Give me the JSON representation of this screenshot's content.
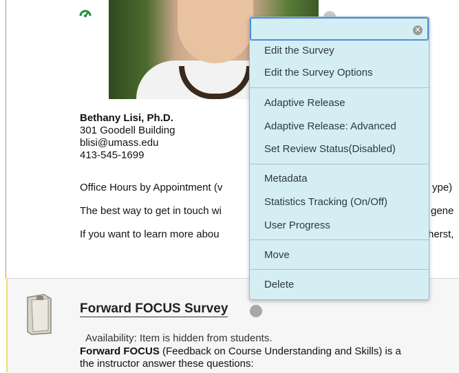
{
  "profile": {
    "name": "Bethany Lisi, Ph.D.",
    "address": "301 Goodell Building",
    "email": "blisi@umass.edu",
    "phone": "413-545-1699",
    "office_hours_visible": "Office Hours by Appointment (v",
    "office_hours_tail": "ype)",
    "contact_line_visible": "The best way to get in touch wi",
    "contact_line_tail": "gene",
    "learn_more_visible": "If you want to learn more abou",
    "learn_more_tail": "herst,"
  },
  "context_menu": {
    "search_value": "",
    "clear_icon": "clear-icon",
    "groups": [
      [
        "Edit the Survey",
        "Edit the Survey Options"
      ],
      [
        "Adaptive Release",
        "Adaptive Release: Advanced",
        "Set Review Status(Disabled)"
      ],
      [
        "Metadata",
        "Statistics Tracking (On/Off)",
        "User Progress"
      ],
      [
        "Move"
      ],
      [
        "Delete"
      ]
    ]
  },
  "content_item": {
    "title": "Forward FOCUS Survey",
    "availability": "Availability:  Item is hidden from students.",
    "description_bold": "Forward FOCUS",
    "description_rest": " (Feedback on Course Understanding and Skills) is a",
    "description_line2": "the instructor answer these questions:",
    "icon": "survey-document-icon"
  },
  "colors": {
    "menu_bg": "#d5eef3",
    "menu_border": "#9fb9c2",
    "search_focus": "#4a90d9",
    "tracking_icon": "#1a8f3a"
  }
}
